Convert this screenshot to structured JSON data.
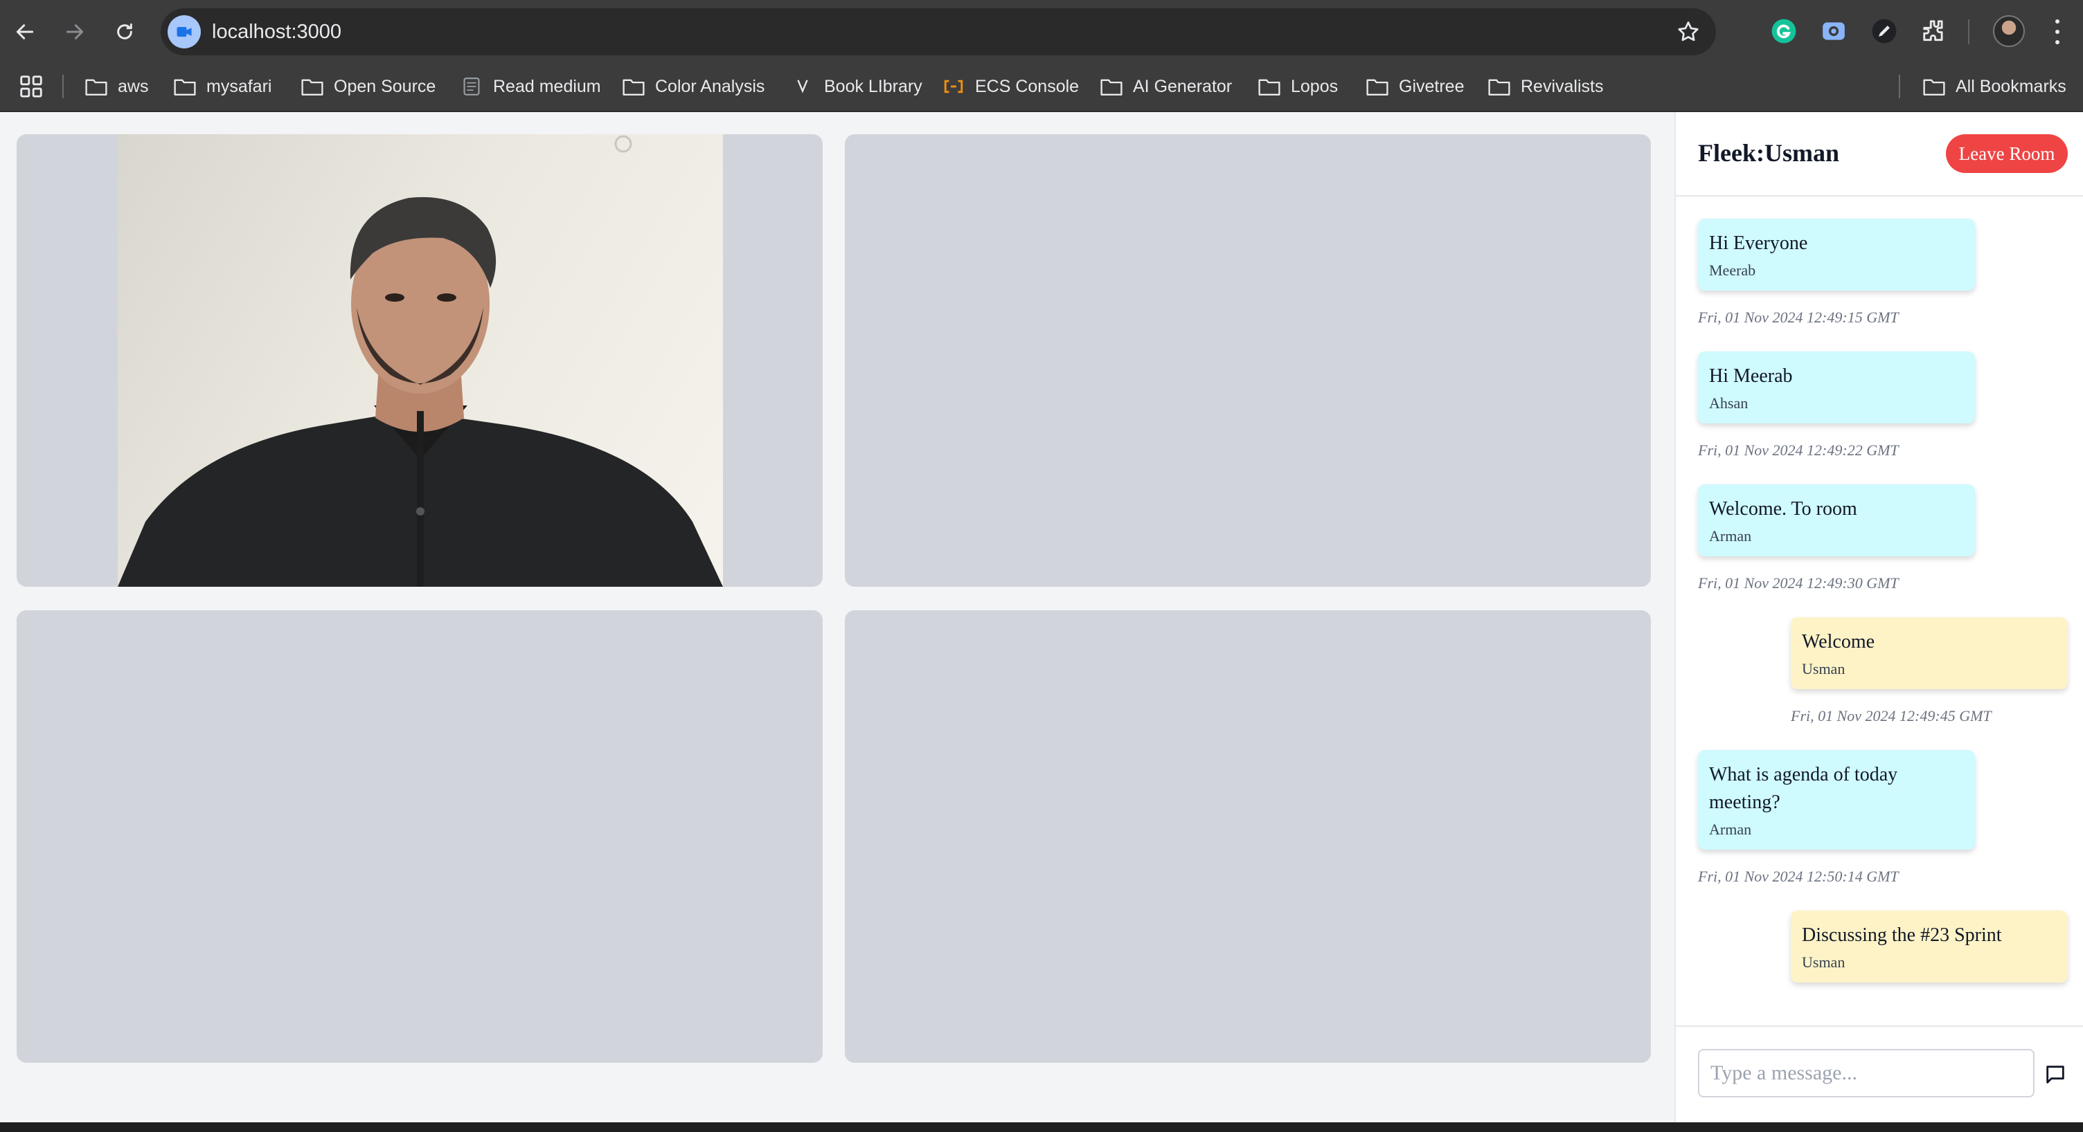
{
  "browser": {
    "url": "localhost:3000",
    "bookmarks": [
      {
        "label": "aws",
        "icon": "folder-icon"
      },
      {
        "label": "mysafari",
        "icon": "folder-icon"
      },
      {
        "label": "Open Source",
        "icon": "folder-icon"
      },
      {
        "label": "Read medium",
        "icon": "page-icon"
      },
      {
        "label": "Color Analysis",
        "icon": "folder-icon"
      },
      {
        "label": "Book LIbrary",
        "icon": "v-logo-icon"
      },
      {
        "label": "ECS Console",
        "icon": "aws-logo-icon"
      },
      {
        "label": "AI Generator",
        "icon": "folder-icon"
      },
      {
        "label": "Lopos",
        "icon": "folder-icon"
      },
      {
        "label": "Givetree",
        "icon": "folder-icon"
      },
      {
        "label": "Revivalists",
        "icon": "folder-icon"
      }
    ],
    "all_bookmarks": "All Bookmarks"
  },
  "chat": {
    "title": "Fleek:Usman",
    "leave_label": "Leave Room",
    "input_placeholder": "Type a message...",
    "messages": [
      {
        "text": "Hi Everyone",
        "author": "Meerab",
        "time": "Fri, 01 Nov 2024 12:49:15 GMT",
        "self": false
      },
      {
        "text": "Hi Meerab",
        "author": "Ahsan",
        "time": "Fri, 01 Nov 2024 12:49:22 GMT",
        "self": false
      },
      {
        "text": "Welcome. To room",
        "author": "Arman",
        "time": "Fri, 01 Nov 2024 12:49:30 GMT",
        "self": false
      },
      {
        "text": "Welcome",
        "author": "Usman",
        "time": "Fri, 01 Nov 2024 12:49:45 GMT",
        "self": true
      },
      {
        "text": "What is agenda of today meeting?",
        "author": "Arman",
        "time": "Fri, 01 Nov 2024 12:50:14 GMT",
        "self": false
      },
      {
        "text": "Discussing the #23 Sprint",
        "author": "Usman",
        "time": "",
        "self": true
      }
    ]
  },
  "colors": {
    "other_bubble": "#cffafe",
    "self_bubble": "#fef3c7",
    "leave_button": "#ef4444",
    "tile": "#d1d5db"
  }
}
